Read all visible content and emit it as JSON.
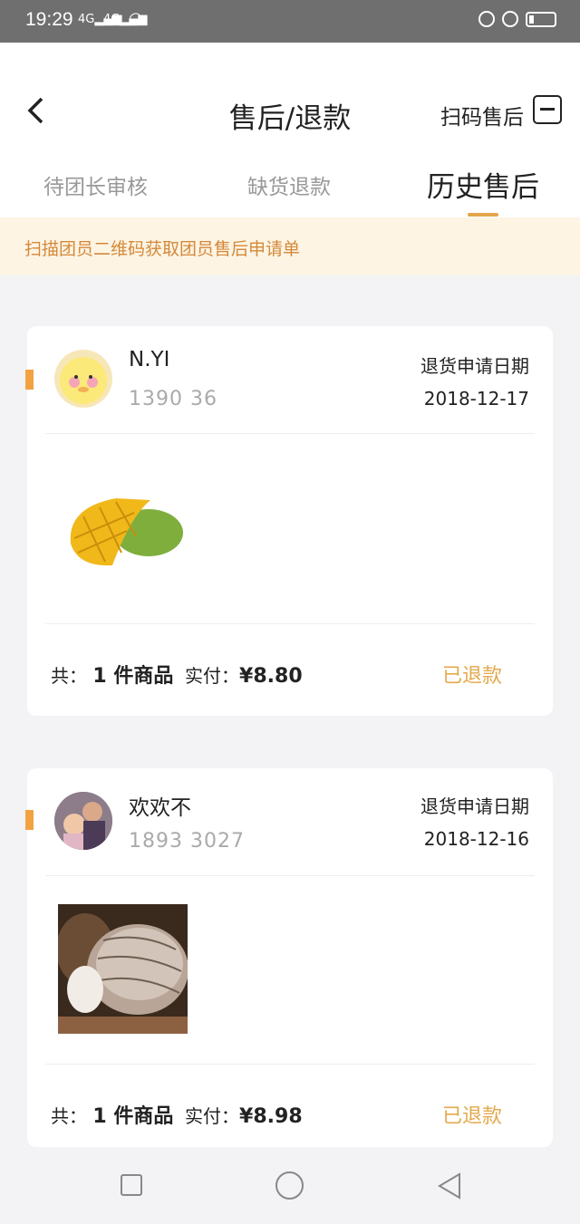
{
  "status_bar": {
    "time": "19:29",
    "signal1": "4G",
    "signal2": "4G"
  },
  "header": {
    "title": "售后/退款",
    "scan_label": "扫码售后"
  },
  "tabs": [
    {
      "label": "待团长审核",
      "active": false
    },
    {
      "label": "缺货退款",
      "active": false
    },
    {
      "label": "历史售后",
      "active": true
    }
  ],
  "banner": {
    "text": "扫描团员二维码获取团员售后申请单"
  },
  "orders": [
    {
      "name": "N.YI",
      "phone": "1390      36",
      "date_label": "退货申请日期",
      "date": "2018-12-17",
      "total_prefix": "共：",
      "count_text": "1 件商品",
      "paid_label": "实付：",
      "paid_amount": "¥8.80",
      "status": "已退款",
      "product_icon": "mango-image"
    },
    {
      "name": "欢欢不",
      "phone": "1893    3027",
      "date_label": "退货申请日期",
      "date": "2018-12-16",
      "total_prefix": "共：",
      "count_text": "1 件商品",
      "paid_label": "实付：",
      "paid_amount": "¥8.98",
      "status": "已退款",
      "product_icon": "taro-image"
    }
  ],
  "colors": {
    "accent": "#e4a44a",
    "banner_bg": "#fdf4e3",
    "banner_text": "#d4893a",
    "status": "#e3a94d"
  }
}
